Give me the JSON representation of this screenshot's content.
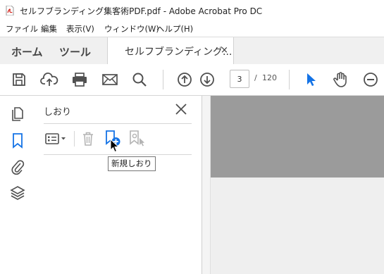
{
  "window": {
    "title": "セルフブランディング集客術PDF.pdf - Adobe Acrobat Pro DC"
  },
  "menu": {
    "items": [
      "ファイル",
      "編集",
      "表示(V)",
      "ウィンドウ(W)",
      "ヘルプ(H)"
    ]
  },
  "tabs": {
    "home": "ホーム",
    "tools": "ツール",
    "document": "セルフブランディング...",
    "close_glyph": "×"
  },
  "toolbar": {
    "current_page": "3",
    "page_separator": "/",
    "total_pages": "120"
  },
  "panel": {
    "title": "しおり",
    "tooltip": "新規しおり"
  },
  "colors": {
    "accent": "#1473e6",
    "icon_gray": "#505050",
    "disabled_gray": "#b4b4b4",
    "document_background": "#9b9b9b"
  }
}
